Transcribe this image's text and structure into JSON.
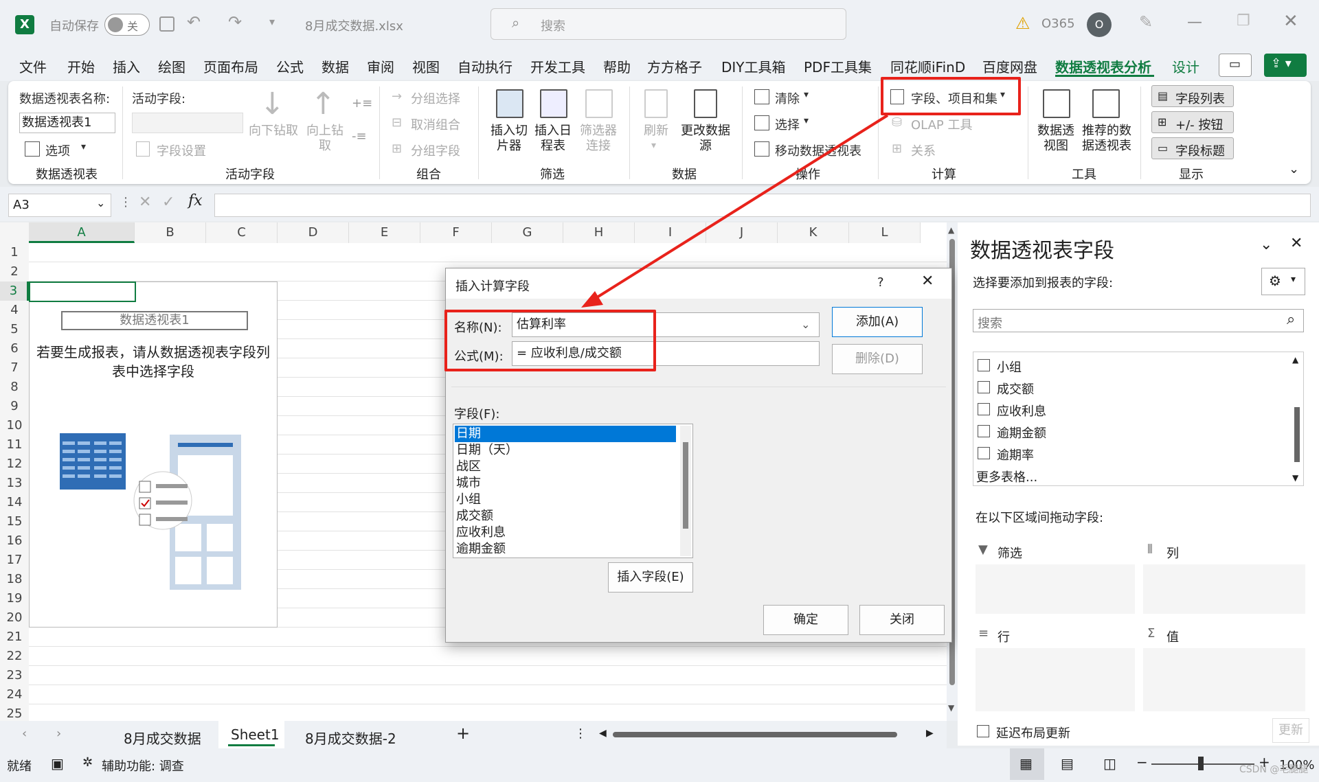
{
  "titlebar": {
    "autosave_label": "自动保存",
    "autosave_state": "关",
    "filename": "8月成交数据.xlsx",
    "search_placeholder": "搜索",
    "account": "O365",
    "avatar_letter": "O"
  },
  "menu": [
    "文件",
    "开始",
    "插入",
    "绘图",
    "页面布局",
    "公式",
    "数据",
    "审阅",
    "视图",
    "自动执行",
    "开发工具",
    "帮助",
    "方方格子",
    "DIY工具箱",
    "PDF工具集",
    "同花顺iFinD",
    "百度网盘",
    "数据透视表分析",
    "设计"
  ],
  "ribbon": {
    "pivot_name_label": "数据透视表名称:",
    "pivot_name_value": "数据透视表1",
    "options_label": "选项",
    "group_pivot": "数据透视表",
    "active_field_label": "活动字段:",
    "field_settings": "字段设置",
    "drill_down": "向下钻取",
    "drill_up": "向上钻取",
    "group_active": "活动字段",
    "group_selection": "分组选择",
    "ungroup": "取消组合",
    "group_field": "分组字段",
    "group_group": "组合",
    "insert_slicer": "插入切片器",
    "insert_timeline": "插入日程表",
    "filter_connections": "筛选器连接",
    "group_filter": "筛选",
    "refresh": "刷新",
    "change_source": "更改数据源",
    "group_data": "数据",
    "clear": "清除",
    "select": "选择",
    "move_pivot": "移动数据透视表",
    "group_actions": "操作",
    "fields_items_sets": "字段、项目和集",
    "olap_tools": "OLAP 工具",
    "relationships": "关系",
    "group_calc": "计算",
    "pivotchart": "数据透视图",
    "recommended": "推荐的数据透视表",
    "group_tools": "工具",
    "field_list": "字段列表",
    "plus_minus": "+/- 按钮",
    "field_headers": "字段标题",
    "group_show": "显示"
  },
  "formula_bar": {
    "name_box": "A3",
    "fx": "fx",
    "formula": ""
  },
  "grid": {
    "columns": [
      "A",
      "B",
      "C",
      "D",
      "E",
      "F",
      "G",
      "H",
      "I",
      "J",
      "K",
      "L"
    ],
    "rows": [
      "1",
      "2",
      "3",
      "4",
      "5",
      "6",
      "7",
      "8",
      "9",
      "10",
      "11",
      "12",
      "13",
      "14",
      "15",
      "16",
      "17",
      "18",
      "19",
      "20",
      "21",
      "22",
      "23",
      "24",
      "25"
    ],
    "pivot_title": "数据透视表1",
    "pivot_hint": "若要生成报表，请从数据透视表字段列表中选择字段"
  },
  "dialog": {
    "title": "插入计算字段",
    "help": "?",
    "name_label": "名称(N):",
    "name_value": "估算利率",
    "formula_label": "公式(M):",
    "formula_value": "= 应收利息/成交额",
    "add_button": "添加(A)",
    "delete_button": "删除(D)",
    "fields_label": "字段(F):",
    "fields": [
      "日期",
      "日期（天）",
      "战区",
      "城市",
      "小组",
      "成交额",
      "应收利息",
      "逾期金额"
    ],
    "selected_field": "日期",
    "insert_field_button": "插入字段(E)",
    "ok_button": "确定",
    "close_button": "关闭"
  },
  "pane": {
    "title": "数据透视表字段",
    "subtitle": "选择要添加到报表的字段:",
    "search_placeholder": "搜索",
    "fields": [
      "小组",
      "成交额",
      "应收利息",
      "逾期金额",
      "逾期率"
    ],
    "more_tables": "更多表格...",
    "drag_label": "在以下区域间拖动字段:",
    "area_filter": "筛选",
    "area_columns": "列",
    "area_rows": "行",
    "area_values": "值",
    "defer_label": "延迟布局更新",
    "update_button": "更新"
  },
  "sheets": {
    "tabs": [
      "8月成交数据",
      "Sheet1",
      "8月成交数据-2"
    ],
    "active": "Sheet1"
  },
  "status": {
    "ready": "就绪",
    "accessibility": "辅助功能: 调查",
    "zoom": "100%",
    "watermark": "CSDN @毛腿腿"
  },
  "colors": {
    "accent_green": "#107c41",
    "highlight_red": "#e8221b",
    "selection_blue": "#0078d7"
  }
}
